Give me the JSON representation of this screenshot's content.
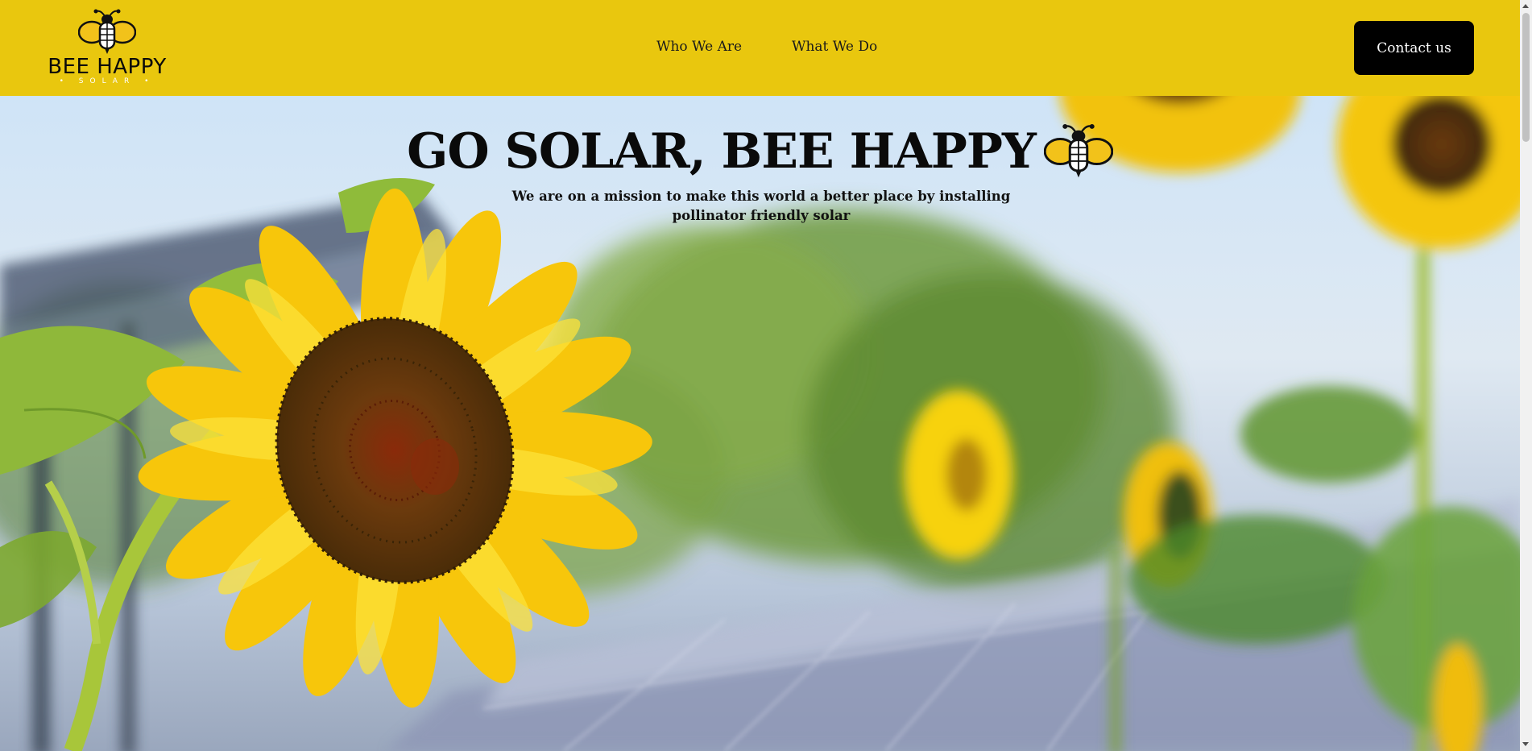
{
  "brand": {
    "name": "BEE HAPPY",
    "tagline": "SOLAR",
    "logo_icon": "bee-icon"
  },
  "nav": [
    {
      "label": "Who We Are"
    },
    {
      "label": "What We Do"
    }
  ],
  "header": {
    "contact_label": "Contact us",
    "background_color": "#e9c70e"
  },
  "hero": {
    "title": "GO SOLAR, BEE HAPPY",
    "subtitle": "We are on a mission to make this world a better place by installing pollinator friendly solar",
    "title_icon": "bee-icon",
    "background": "sunflowers-in-front-of-solar-panels"
  }
}
